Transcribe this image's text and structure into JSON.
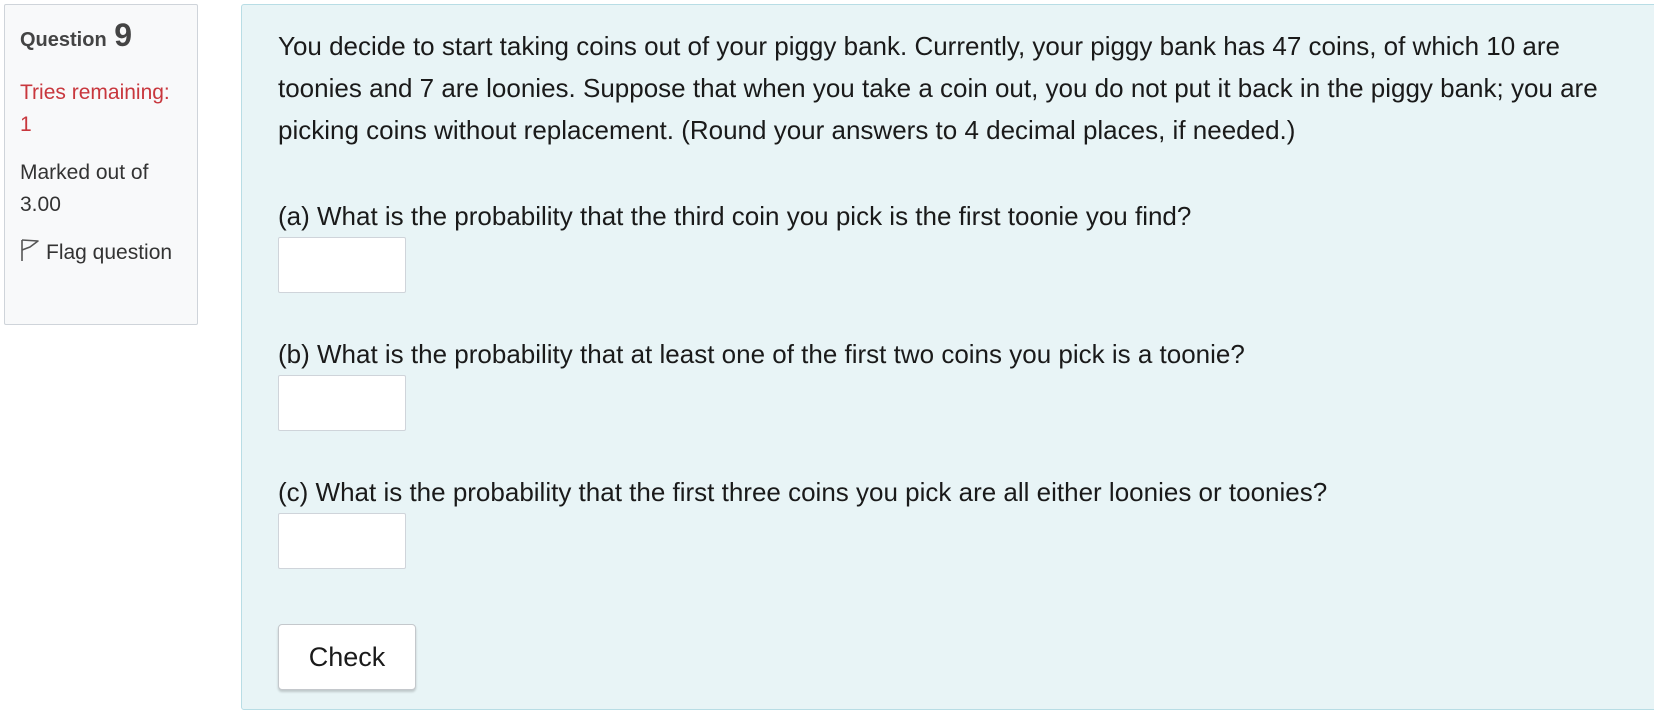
{
  "info": {
    "question_label": "Question",
    "question_number": "9",
    "tries_remaining": "Tries remaining: 1",
    "marked_out_of": "Marked out of 3.00",
    "flag_label": "Flag question",
    "tries_color": "#c8373d"
  },
  "question": {
    "text": "You decide to start taking coins out of your piggy bank. Currently, your piggy bank has 47 coins, of which 10 are toonies and 7 are loonies. Suppose that when you take a coin out, you do not put it back in the piggy bank; you are picking coins without replacement. (Round your answers to 4 decimal places, if needed.)",
    "parts": [
      {
        "label": "(a) What is the probability that the third coin you pick is the first toonie you find?",
        "value": ""
      },
      {
        "label": "(b) What is the probability that at least one of the first two coins you pick is a toonie?",
        "value": ""
      },
      {
        "label": "(c) What is the probability that the first three coins you pick are all either loonies or toonies?",
        "value": ""
      }
    ],
    "check_label": "Check"
  },
  "icons": {
    "flag": "flag-icon"
  },
  "colors": {
    "content_background": "#e8f4f6",
    "info_background": "#f8f9fa"
  }
}
